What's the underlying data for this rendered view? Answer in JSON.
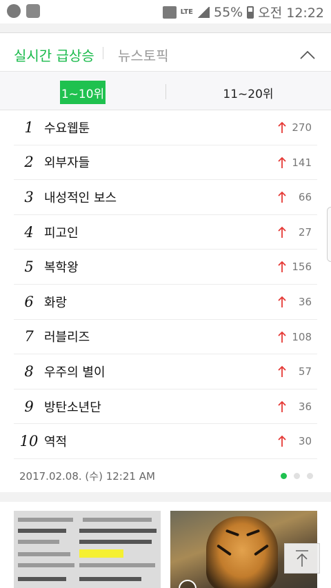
{
  "status_bar": {
    "network": "LTE",
    "battery": "55%",
    "time": "오전 12:22"
  },
  "header": {
    "active_tab": "실시간 급상승",
    "other_tab": "뉴스토픽"
  },
  "range_tabs": {
    "active": "1~10위",
    "second": "11~20위"
  },
  "ranking": [
    {
      "rank": "1",
      "keyword": "수요웹툰",
      "change": "270"
    },
    {
      "rank": "2",
      "keyword": "외부자들",
      "change": "141"
    },
    {
      "rank": "3",
      "keyword": "내성적인 보스",
      "change": "66"
    },
    {
      "rank": "4",
      "keyword": "피고인",
      "change": "27"
    },
    {
      "rank": "5",
      "keyword": "복학왕",
      "change": "156"
    },
    {
      "rank": "6",
      "keyword": "화랑",
      "change": "36"
    },
    {
      "rank": "7",
      "keyword": "러블리즈",
      "change": "108"
    },
    {
      "rank": "8",
      "keyword": "우주의 별이",
      "change": "57"
    },
    {
      "rank": "9",
      "keyword": "방탄소년단",
      "change": "36"
    },
    {
      "rank": "10",
      "keyword": "역적",
      "change": "30"
    }
  ],
  "timestamp": "2017.02.08. (수) 12:21 AM",
  "colors": {
    "accent": "#1fc14f",
    "up_arrow": "#e53935"
  }
}
